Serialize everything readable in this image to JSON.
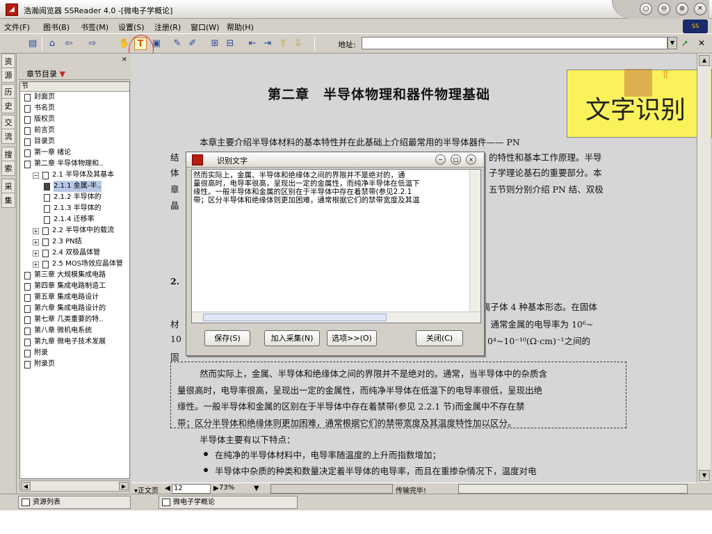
{
  "window": {
    "title": "浩瀚阅览器 SSReader 4.0 -[微电子学概论]"
  },
  "menubar": {
    "items": [
      "文件(F)",
      "图书(B)",
      "书签(M)",
      "设置(S)",
      "注册(R)",
      "窗口(W)",
      "帮助(H)"
    ]
  },
  "toolbar": {
    "address_label": "地址:",
    "address_value": "",
    "text_tool_glyph": "T"
  },
  "left_tabs": [
    "资",
    "源",
    "历",
    "史",
    "交",
    "流",
    "搜",
    "索",
    "采",
    "集"
  ],
  "panel": {
    "header_label": "章节目录",
    "header_arrow": "▼",
    "column_label": "节",
    "tree": [
      {
        "label": "封面页",
        "indent": 0,
        "expander": ""
      },
      {
        "label": "书名页",
        "indent": 0,
        "expander": ""
      },
      {
        "label": "版权页",
        "indent": 0,
        "expander": ""
      },
      {
        "label": "前言页",
        "indent": 0,
        "expander": ""
      },
      {
        "label": "目录页",
        "indent": 0,
        "expander": ""
      },
      {
        "label": "第一章 绪论",
        "indent": 0,
        "expander": ""
      },
      {
        "label": "第二章 半导体物理和..",
        "indent": 0,
        "expander": ""
      },
      {
        "label": "2.1 半导体及其基本",
        "indent": 1,
        "expander": "−"
      },
      {
        "label": "2.1.1 金属-半..",
        "indent": 2,
        "expander": "",
        "selected": true
      },
      {
        "label": "2.1.2 半导体的",
        "indent": 2,
        "expander": ""
      },
      {
        "label": "2.1.3 半导体的",
        "indent": 2,
        "expander": ""
      },
      {
        "label": "2.1.4 迁移率",
        "indent": 2,
        "expander": ""
      },
      {
        "label": "2.2 半导体中的载流",
        "indent": 1,
        "expander": "+"
      },
      {
        "label": "2.3 PN结",
        "indent": 1,
        "expander": "+"
      },
      {
        "label": "2.4 双极晶体管",
        "indent": 1,
        "expander": "+"
      },
      {
        "label": "2.5 MOS场效应晶体管",
        "indent": 1,
        "expander": "+"
      },
      {
        "label": "第三章 大规模集成电路",
        "indent": 0,
        "expander": ""
      },
      {
        "label": "第四章 集成电路制造工",
        "indent": 0,
        "expander": ""
      },
      {
        "label": "第五章 集成电路设计",
        "indent": 0,
        "expander": ""
      },
      {
        "label": "第六章 集成电路设计的",
        "indent": 0,
        "expander": ""
      },
      {
        "label": "第七章 几类重要的特..",
        "indent": 0,
        "expander": ""
      },
      {
        "label": "第八章 微机电系统",
        "indent": 0,
        "expander": ""
      },
      {
        "label": "第九章 微电子技术发展",
        "indent": 0,
        "expander": ""
      },
      {
        "label": "附录",
        "indent": 0,
        "expander": ""
      },
      {
        "label": "附录页",
        "indent": 0,
        "expander": ""
      }
    ]
  },
  "page": {
    "chapter_title": "第二章　半导体物理和器件物理基础",
    "intro": [
      "本章主要介绍半导体材料的基本特性并在此基础上介绍最常用的半导体器件—— PN",
      "结",
      "体",
      "章",
      "晶"
    ],
    "intro_right": [
      "的特性和基本工作原理。半导",
      "子学理论基石的重要部分。本",
      "五节则分别介绍 PN 结、双极"
    ],
    "section_num": "2.",
    "mid_lines": [
      "离子体 4 种基本形态。在固体",
      "。通常金属的电导率为 10⁶~",
      "10⁴~10⁻¹⁰(Ω·cm)⁻¹之间的"
    ],
    "mid_left": [
      "材",
      "10",
      "固"
    ],
    "highlight_lines": [
      "然而实际上，金属、半导体和绝缘体之间的界限并不是绝对的。通常，当半导体中的杂质含",
      "量很高时，电导率很高，呈现出一定的金属性，而纯净半导体在低温下的电导率很低，呈现出绝",
      "缘性。一般半导体和金属的区别在于半导体中存在着禁带(参见 2.2.1 节)而金属中不存在禁",
      "带；区分半导体和绝缘体则更加困难，通常根据它们的禁带宽度及其温度特性加以区分。"
    ],
    "features_title": "半导体主要有以下特点：",
    "bullets": [
      "在纯净的半导体材料中，电导率随温度的上升而指数增加；",
      "半导体中杂质的种类和数量决定着半导体的电导率，而且在重掺杂情况下，温度对电"
    ]
  },
  "callout": {
    "text": "文字识别"
  },
  "dialog": {
    "title": "识别文字",
    "text_lines": [
      "    然而实际上，金属、半导体和绝缘体之间的界限并不是绝对的，通",
      "量很高时，电导率很高，呈现出一定的金属性，而纯净半导体在低温下",
      "缘性。一般半导体和金属的区别在于半导体中存在着禁带(参见2.2.1",
      "带；区分半导体和绝缘体则更加困难，通常根据它们的禁带宽度及其温"
    ],
    "buttons": {
      "save": "保存(S)",
      "add_collect": "加入采集(N)",
      "options": "选项>>(O)",
      "close": "关闭(C)"
    }
  },
  "statusbar": {
    "view_mode": "▾正文页",
    "page_number": "12",
    "zoom": "73%",
    "status_text": "传输完毕!"
  },
  "taskbar": {
    "resource_list": "资源列表",
    "doc_tab": "微电子学概论"
  }
}
